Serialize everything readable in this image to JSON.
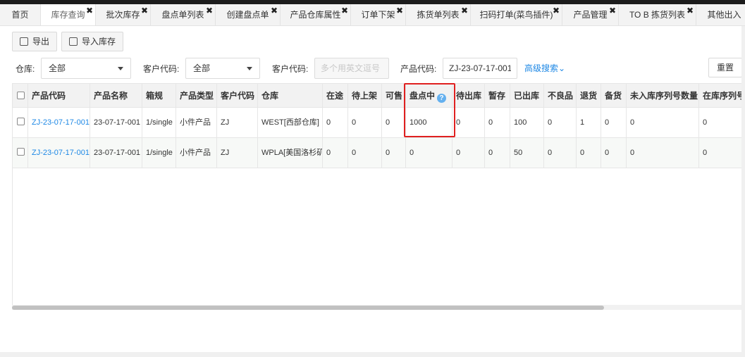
{
  "tabs": [
    {
      "label": "首页",
      "closable": false,
      "active": false
    },
    {
      "label": "库存查询",
      "closable": true,
      "active": true
    },
    {
      "label": "批次库存",
      "closable": true,
      "active": false
    },
    {
      "label": "盘点单列表",
      "closable": true,
      "active": false
    },
    {
      "label": "创建盘点单",
      "closable": true,
      "active": false
    },
    {
      "label": "产品仓库属性",
      "closable": true,
      "active": false
    },
    {
      "label": "订单下架",
      "closable": true,
      "active": false
    },
    {
      "label": "拣货单列表",
      "closable": true,
      "active": false
    },
    {
      "label": "扫码打单(菜鸟插件)",
      "closable": true,
      "active": false
    },
    {
      "label": "产品管理",
      "closable": true,
      "active": false
    },
    {
      "label": "TO B 拣货列表",
      "closable": true,
      "active": false
    },
    {
      "label": "其他出入",
      "closable": false,
      "active": false
    }
  ],
  "tab_close_glyph": "✖",
  "toolbar": {
    "export_label": "导出",
    "import_label": "导入库存"
  },
  "filters": {
    "warehouse_label": "仓库:",
    "warehouse_value": "全部",
    "customer_code_label": "客户代码:",
    "customer_code_value": "全部",
    "batch_label": "客户代码:",
    "batch_placeholder": "多个用英文逗号",
    "product_code_label": "产品代码:",
    "product_code_value": "ZJ-23-07-17-001",
    "advanced_search": "高级搜索⌄",
    "reset": "重置"
  },
  "table": {
    "columns": [
      "产品代码",
      "产品名称",
      "箱规",
      "产品类型",
      "客户代码",
      "仓库",
      "在途",
      "待上架",
      "可售",
      "盘点中",
      "待出库",
      "暂存",
      "已出库",
      "不良品",
      "退货",
      "备货",
      "未入库序列号数量",
      "在库序列号"
    ],
    "rows": [
      [
        "ZJ-23-07-17-001",
        "23-07-17-001",
        "1/single",
        "小件产品",
        "ZJ",
        "WEST[西部仓库]",
        "0",
        "0",
        "0",
        "1000",
        "0",
        "0",
        "100",
        "0",
        "1",
        "0",
        "0",
        "0"
      ],
      [
        "ZJ-23-07-17-001",
        "23-07-17-001",
        "1/single",
        "小件产品",
        "ZJ",
        "WPLA[美国洛杉矶]",
        "0",
        "0",
        "0",
        "0",
        "0",
        "0",
        "50",
        "0",
        "0",
        "0",
        "0",
        "0"
      ]
    ]
  },
  "colors": {
    "accent": "#1e88e5",
    "highlight": "#e02020"
  }
}
